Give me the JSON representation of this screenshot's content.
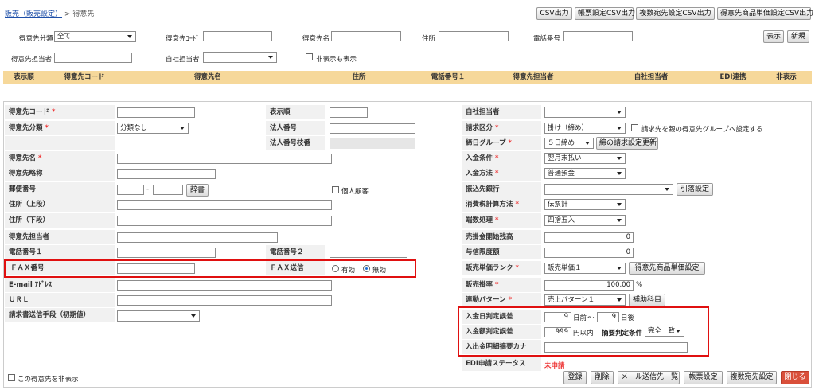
{
  "breadcrumb": {
    "parent": "販売（販売設定）",
    "sep": ">",
    "current": "得意先"
  },
  "top_buttons": [
    "CSV出力",
    "帳票設定CSV出力",
    "複数宛先設定CSV出力",
    "得意先商品単価設定CSV出力"
  ],
  "search": {
    "category_label": "得意先分類",
    "category_value": "全て",
    "code_label": "得意先ｺｰﾄﾞ",
    "code_value": "",
    "name_label": "得意先名",
    "name_value": "",
    "address_label": "住所",
    "address_value": "",
    "phone_label": "電話番号",
    "phone_value": "",
    "rep_label": "得意先担当者",
    "rep_value": "",
    "own_label": "自社担当者",
    "own_value": "",
    "show_hidden_label": "非表示も表示",
    "show_button": "表示",
    "new_button": "新規"
  },
  "table_headers": [
    "表示順",
    "得意先コード",
    "得意先名",
    "住所",
    "電話番号１",
    "得意先担当者",
    "自社担当者",
    "EDI連携",
    "非表示"
  ],
  "form": {
    "code": {
      "label": "得意先コード",
      "required": "*",
      "value": ""
    },
    "category": {
      "label": "得意先分類",
      "required": "*",
      "value": "分類なし"
    },
    "name": {
      "label": "得意先名",
      "required": "*",
      "value": ""
    },
    "short_name": {
      "label": "得意先略称",
      "value": ""
    },
    "postal": {
      "label": "郵便番号",
      "value1": "",
      "dash": "-",
      "value2": "",
      "dict_button": "辞書",
      "individual_label": "個人顧客"
    },
    "addr1": {
      "label": "住所（上段）",
      "value": ""
    },
    "addr2": {
      "label": "住所（下段）",
      "value": ""
    },
    "contact": {
      "label": "得意先担当者",
      "value": ""
    },
    "phone1": {
      "label": "電話番号１",
      "value": ""
    },
    "phone2": {
      "label": "電話番号２",
      "value": ""
    },
    "fax": {
      "label": "ＦＡＸ番号",
      "value": ""
    },
    "fax_send": {
      "label": "ＦＡＸ送信",
      "opt_on": "有効",
      "opt_off": "無効",
      "selected": "無効"
    },
    "email": {
      "label": "E-mail ｱﾄﾞﾚｽ",
      "value": ""
    },
    "url": {
      "label": "ＵＲＬ",
      "value": ""
    },
    "invoice_method": {
      "label": "請求書送信手段（初期値）",
      "value": ""
    },
    "display_order": {
      "label": "表示順",
      "value": ""
    },
    "corp_no": {
      "label": "法人番号",
      "value": ""
    },
    "corp_branch": {
      "label": "法人番号枝番",
      "value": ""
    },
    "own_rep": {
      "label": "自社担当者",
      "value": ""
    },
    "billing_type": {
      "label": "請求区分",
      "required": "*",
      "value": "掛け（締め）",
      "parent_group_label": "請求先を親の得意先グループへ設定する"
    },
    "closing_group": {
      "label": "締日グループ",
      "required": "*",
      "value": "５日締め",
      "update_button": "締の請求設定更新"
    },
    "payment_terms": {
      "label": "入金条件",
      "required": "*",
      "value": "翌月末払い"
    },
    "payment_method": {
      "label": "入金方法",
      "required": "*",
      "value": "普通預金"
    },
    "bank": {
      "label": "振込先銀行",
      "value": "",
      "withdraw_button": "引落設定"
    },
    "tax_method": {
      "label": "消費税計算方法",
      "required": "*",
      "value": "伝票計"
    },
    "rounding": {
      "label": "端数処理",
      "required": "*",
      "value": "四捨五入"
    },
    "ar_opening": {
      "label": "売掛金開始残高",
      "value": "0"
    },
    "credit_limit": {
      "label": "与信限度額",
      "value": "0"
    },
    "price_rank": {
      "label": "販売単価ランク",
      "required": "*",
      "value": "販売単価１",
      "price_button": "得意先商品単価設定"
    },
    "sales_rate": {
      "label": "販売掛率",
      "required": "*",
      "value": "100.00",
      "unit": "%"
    },
    "link_pattern": {
      "label": "連動パターン",
      "required": "*",
      "value": "売上パターン１",
      "aux_button": "補助科目"
    },
    "date_tolerance": {
      "label": "入金日判定誤差",
      "before": "9",
      "before_unit": "日前",
      "tilde": "～",
      "after": "9",
      "after_unit": "日後"
    },
    "amount_tolerance": {
      "label": "入金額判定誤差",
      "value": "999",
      "unit": "円以内",
      "summary_label": "摘要判定条件",
      "summary_value": "完全一致"
    },
    "detail_kana": {
      "label": "入出金明細摘要カナ",
      "value": ""
    },
    "edi_status": {
      "label": "EDI申請ステータス",
      "value": "未申請"
    }
  },
  "hide_customer_label": "この得意先を非表示",
  "bottom_buttons": {
    "register": "登録",
    "delete": "削除",
    "mail_list": "メール送信先一覧",
    "form_settings": "帳票設定",
    "multi_dest": "複数宛先設定",
    "close": "閉じる"
  },
  "colors": {
    "header_bg": "#f6d89a",
    "highlight": "#e01010",
    "close_btn": "#d94f3a",
    "status_red": "#e33"
  }
}
